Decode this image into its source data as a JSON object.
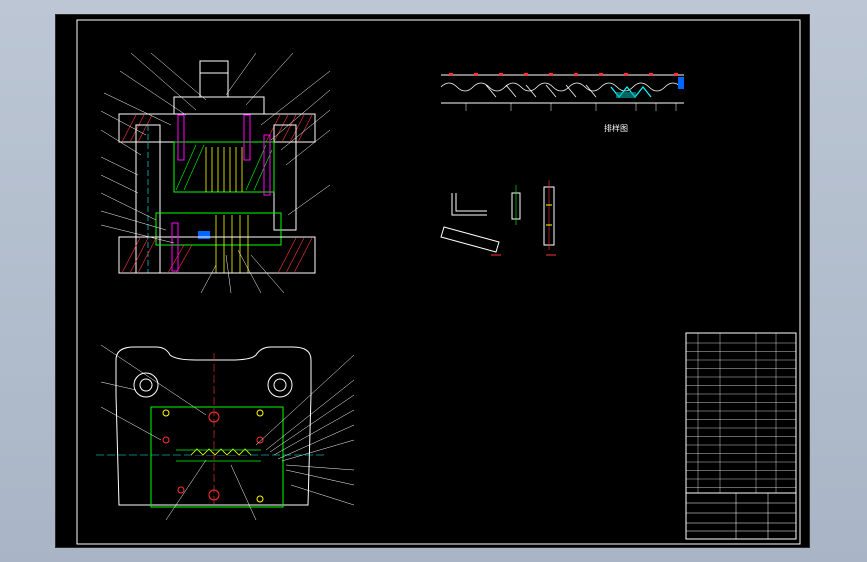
{
  "viewer": {
    "background_color": "#b2bdcc",
    "sheet_color": "#000000"
  },
  "drawing": {
    "line_color": "#ffffff",
    "accent_colors": {
      "hatch": "#ff3333",
      "guide": "#00ff00",
      "part": "#ffff00",
      "feature": "#ff00ff",
      "axis": "#00ffff",
      "insert": "#0066ff"
    },
    "strip_layout": {
      "caption": "排样图"
    }
  }
}
